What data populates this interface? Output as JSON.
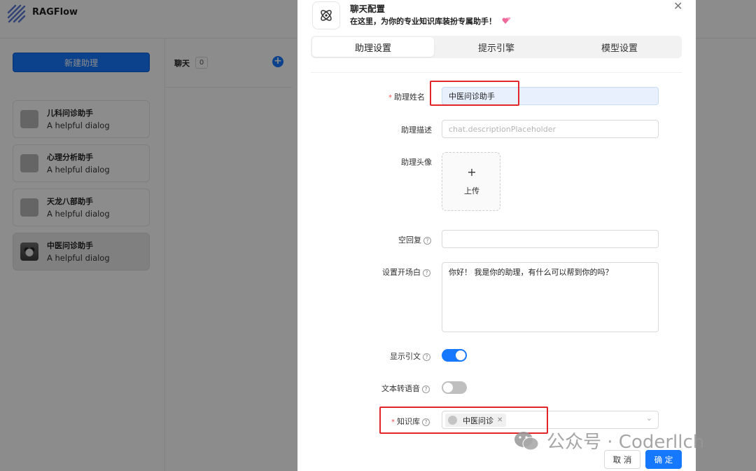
{
  "app": {
    "brand": "RAGFlow",
    "new_assistant_button": "新建助理",
    "chat_title": "聊天",
    "chat_count": "0",
    "assistants": [
      {
        "name": "儿科问诊助手",
        "desc": "A helpful dialog"
      },
      {
        "name": "心理分析助手",
        "desc": "A helpful dialog"
      },
      {
        "name": "天龙八部助手",
        "desc": "A helpful dialog"
      },
      {
        "name": "中医问诊助手",
        "desc": "A helpful dialog"
      }
    ]
  },
  "modal": {
    "title": "聊天配置",
    "subtitle": "在这里，为你的专业知识库装扮专属助手！",
    "tabs": [
      "助理设置",
      "提示引擎",
      "模型设置"
    ],
    "active_tab": "助理设置",
    "form": {
      "name_label": "助理姓名",
      "name_value": "中医问诊助手",
      "desc_label": "助理描述",
      "desc_placeholder": "chat.descriptionPlaceholder",
      "avatar_label": "助理头像",
      "upload_plus": "+",
      "upload_text": "上传",
      "empty_reply_label": "空回复",
      "empty_reply_value": "",
      "opener_label": "设置开场白",
      "opener_value": "你好！ 我是你的助理，有什么可以帮到你的吗？",
      "show_quote_label": "显示引文",
      "show_quote_on": true,
      "tts_label": "文本转语音",
      "tts_on": false,
      "kb_label": "知识库",
      "kb_selected": [
        "中医问诊"
      ]
    },
    "cancel_button": "取 消",
    "ok_button": "确 定"
  },
  "watermark": {
    "text": "公众号 · Coderllch"
  },
  "colors": {
    "primary": "#1677ff",
    "required": "#ff4d4f",
    "highlight_box": "#e0262b"
  }
}
